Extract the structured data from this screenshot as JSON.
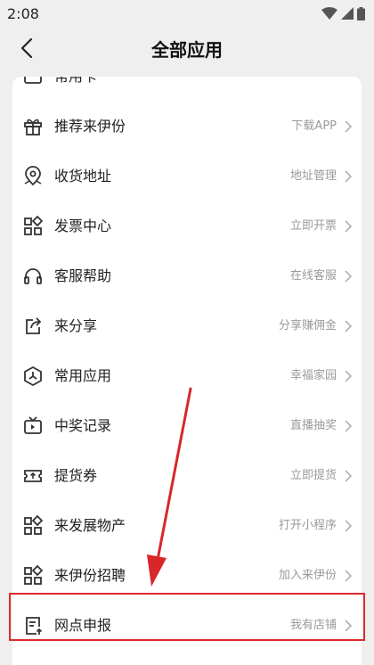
{
  "status_bar": {
    "time": "2:08"
  },
  "header": {
    "title": "全部应用"
  },
  "items": [
    {
      "label": "常用卡",
      "value": "",
      "icon": "card-icon"
    },
    {
      "label": "推荐来伊份",
      "value": "下载APP",
      "icon": "gift-icon"
    },
    {
      "label": "收货地址",
      "value": "地址管理",
      "icon": "location-icon"
    },
    {
      "label": "发票中心",
      "value": "立即开票",
      "icon": "grid-icon"
    },
    {
      "label": "客服帮助",
      "value": "在线客服",
      "icon": "headset-icon"
    },
    {
      "label": "来分享",
      "value": "分享赚佣金",
      "icon": "share-icon"
    },
    {
      "label": "常用应用",
      "value": "幸福家园",
      "icon": "hexagon-icon"
    },
    {
      "label": "中奖记录",
      "value": "直播抽奖",
      "icon": "tv-icon"
    },
    {
      "label": "提货券",
      "value": "立即提货",
      "icon": "ticket-icon"
    },
    {
      "label": "来发展物产",
      "value": "打开小程序",
      "icon": "grid-icon"
    },
    {
      "label": "来伊份招聘",
      "value": "加入来伊份",
      "icon": "grid-icon"
    },
    {
      "label": "网点申报",
      "value": "我有店铺",
      "icon": "document-upload-icon"
    }
  ],
  "colors": {
    "highlight": "#e02a2f",
    "arrow": "#d9262b",
    "background": "#efefef"
  }
}
